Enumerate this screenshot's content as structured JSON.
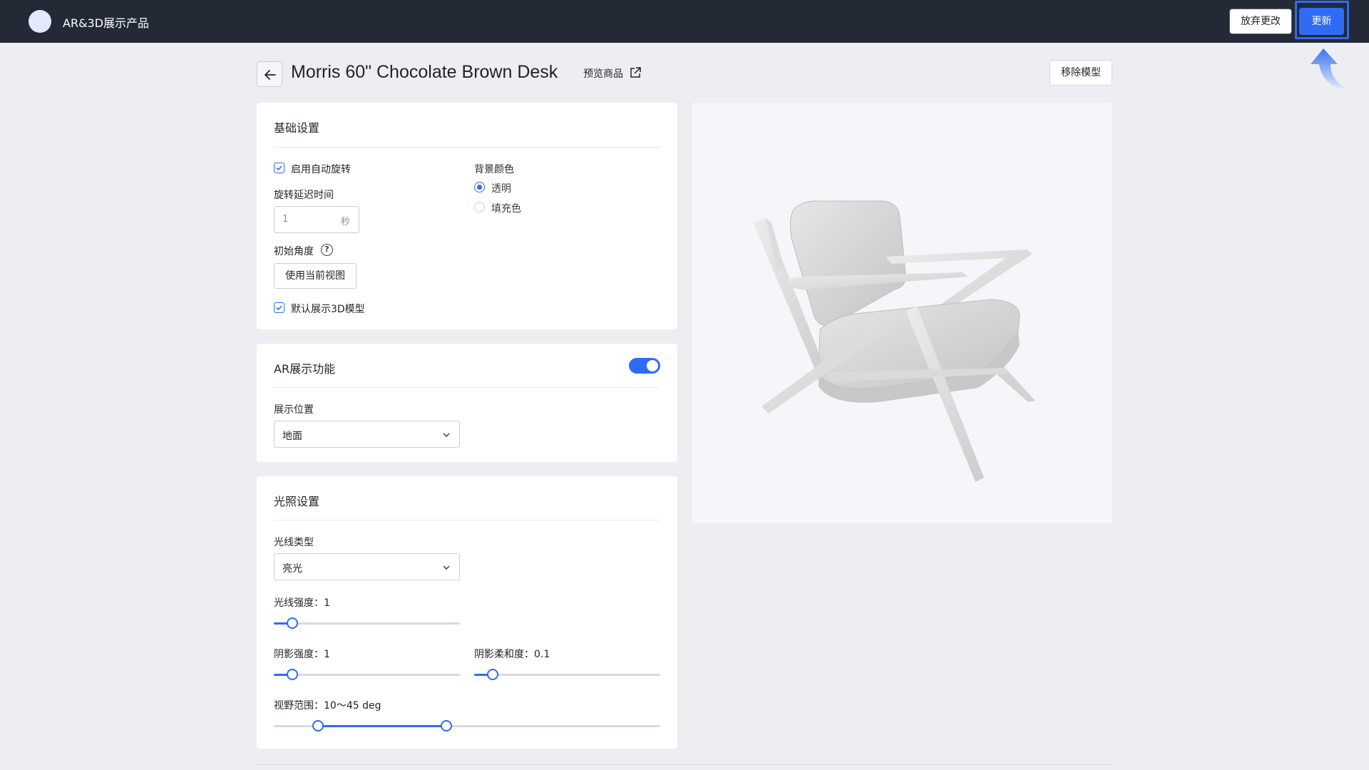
{
  "app": {
    "title": "AR&3D展示产品"
  },
  "header": {
    "discard_label": "放弃更改",
    "update_label": "更新",
    "page_title": "Morris 60\" Chocolate Brown Desk",
    "preview_label": "预览商品",
    "remove_model_label": "移除模型"
  },
  "basic": {
    "title": "基础设置",
    "auto_rotate_label": "启用自动旋转",
    "auto_rotate_checked": true,
    "rotate_delay_label": "旋转延迟时间",
    "rotate_delay_value": "1",
    "rotate_delay_unit": "秒",
    "initial_angle_label": "初始角度",
    "use_current_view_label": "使用当前视图",
    "default_3d_label": "默认展示3D模型",
    "default_3d_checked": true,
    "bg_color_label": "背景颜色",
    "bg_options": [
      {
        "label": "透明",
        "selected": true
      },
      {
        "label": "填充色",
        "selected": false
      }
    ]
  },
  "ar": {
    "title": "AR展示功能",
    "enabled": true,
    "position_label": "展示位置",
    "position_value": "地面"
  },
  "lighting": {
    "title": "光照设置",
    "light_type_label": "光线类型",
    "light_type_value": "亮光",
    "light_intensity_label": "光线强度：1",
    "light_intensity_value": 1,
    "shadow_intensity_label": "阴影强度：1",
    "shadow_intensity_value": 1,
    "shadow_softness_label": "阴影柔和度：0.1",
    "shadow_softness_value": 0.1,
    "fov_label": "视野范围：10～45 deg",
    "fov_range": [
      10,
      45
    ]
  },
  "colors": {
    "accent": "#2f6bf5",
    "topbar_bg": "#232a36",
    "page_bg": "#eceef2"
  },
  "icons": {
    "back": "arrow-left-icon",
    "external": "external-link-icon",
    "help": "question-circle-icon",
    "chevron": "chevron-down-icon",
    "indicator": "curved-arrow-up-icon"
  }
}
